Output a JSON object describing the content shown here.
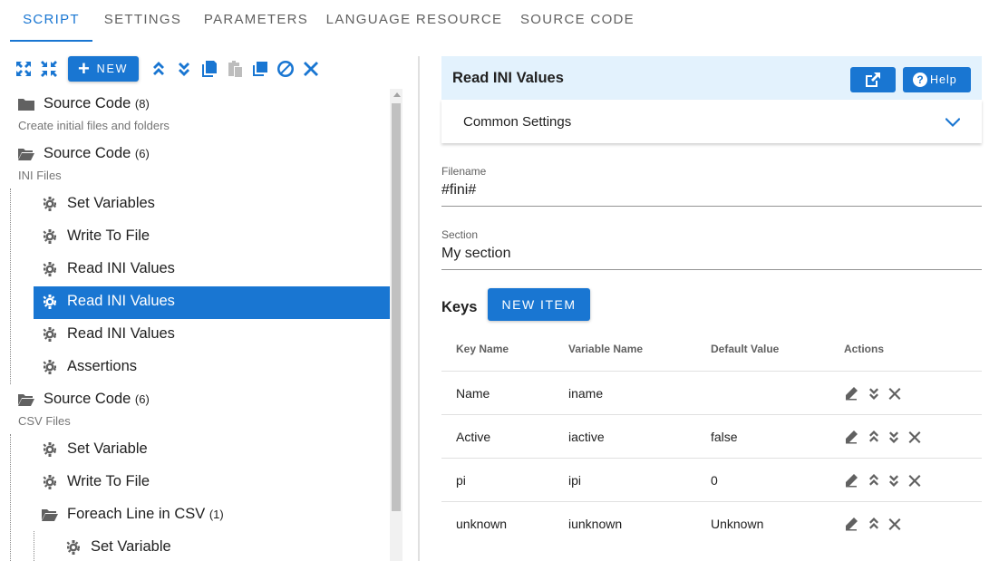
{
  "tabs": [
    "SCRIPT",
    "SETTINGS",
    "PARAMETERS",
    "LANGUAGE RESOURCE",
    "SOURCE CODE"
  ],
  "toolbar": {
    "new_label": "NEW"
  },
  "tree": {
    "group1": {
      "label": "Source Code",
      "count": "(8)",
      "sub": "Create initial files and folders"
    },
    "group2": {
      "label": "Source Code",
      "count": "(6)",
      "sub": "INI Files",
      "items": [
        "Set Variables",
        "Write To File",
        "Read INI Values",
        "Read INI Values",
        "Read INI Values",
        "Assertions"
      ]
    },
    "group3": {
      "label": "Source Code",
      "count": "(6)",
      "sub": "CSV Files",
      "items": [
        "Set Variable",
        "Write To File"
      ],
      "foreach": {
        "label": "Foreach Line in CSV",
        "count": "(1)",
        "items": [
          "Set Variable"
        ]
      }
    }
  },
  "panel": {
    "title": "Read INI Values",
    "help_label": "Help",
    "common_settings": "Common Settings",
    "filename": {
      "label": "Filename",
      "value": "#fini#"
    },
    "section": {
      "label": "Section",
      "value": "My section"
    },
    "keys_label": "Keys",
    "new_item_label": "NEW ITEM",
    "columns": [
      "Key Name",
      "Variable Name",
      "Default Value",
      "Actions"
    ],
    "rows": [
      {
        "key": "Name",
        "variable": "iname",
        "default": "",
        "actions": [
          "edit",
          "down",
          "delete"
        ]
      },
      {
        "key": "Active",
        "variable": "iactive",
        "default": "false",
        "actions": [
          "edit",
          "up",
          "down",
          "delete"
        ]
      },
      {
        "key": "pi",
        "variable": "ipi",
        "default": "0",
        "actions": [
          "edit",
          "up",
          "down",
          "delete"
        ]
      },
      {
        "key": "unknown",
        "variable": "iunknown",
        "default": "Unknown",
        "actions": [
          "edit",
          "up",
          "delete"
        ]
      }
    ]
  },
  "colors": {
    "primary": "#1976d2",
    "header_bg": "#e3f2fd",
    "text": "#212121",
    "muted": "#616161"
  }
}
